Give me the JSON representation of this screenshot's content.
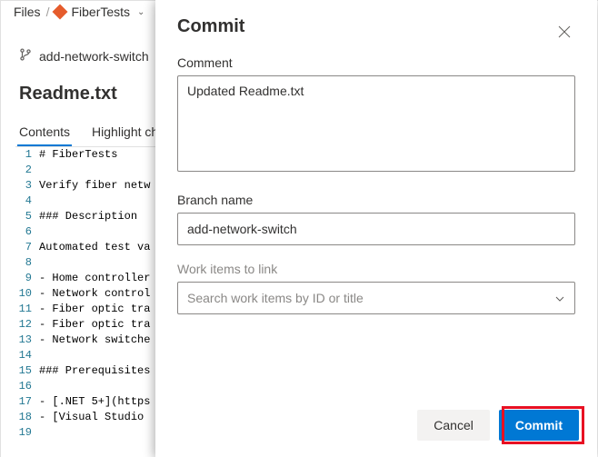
{
  "crumb": {
    "files": "Files",
    "repo": "FiberTests"
  },
  "branchbar": {
    "name": "add-network-switch"
  },
  "file": {
    "title": "Readme.txt"
  },
  "tabs": {
    "contents": "Contents",
    "highlight": "Highlight cha"
  },
  "code": [
    "# FiberTests",
    "",
    "Verify fiber netw",
    "",
    "### Description",
    "",
    "Automated test va",
    "",
    "- Home controller",
    "- Network control",
    "- Fiber optic tra",
    "- Fiber optic tra",
    "- Network switche",
    "",
    "### Prerequisites",
    "",
    "- [.NET 5+](https",
    "- [Visual Studio ",
    ""
  ],
  "modal": {
    "title": "Commit",
    "comment_label": "Comment",
    "comment_value": "Updated Readme.txt",
    "branch_label": "Branch name",
    "branch_value": "add-network-switch",
    "workitems_label": "Work items to link",
    "workitems_placeholder": "Search work items by ID or title",
    "cancel": "Cancel",
    "commit": "Commit"
  }
}
